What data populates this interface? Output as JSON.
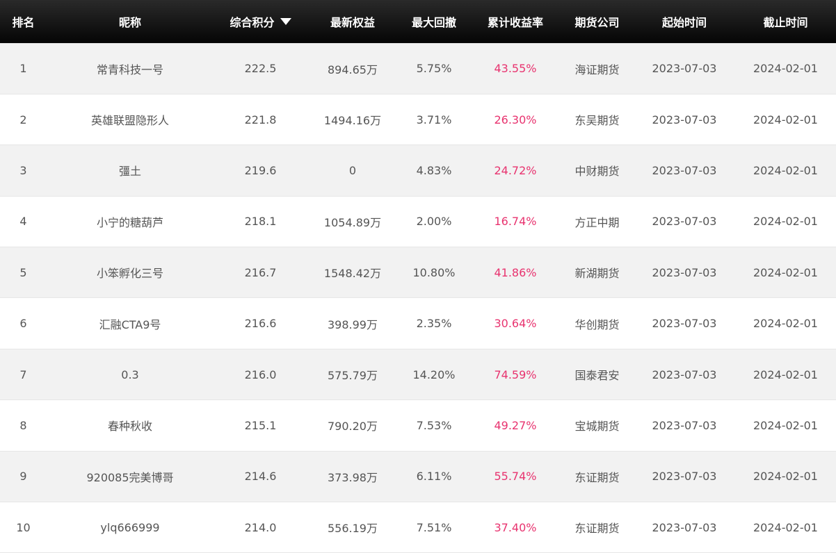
{
  "colors": {
    "header_bg": "#111111",
    "header_text": "#ffffff",
    "row_alt_bg": "#f2f2f2",
    "row_bg": "#ffffff",
    "text": "#555555",
    "rate_text": "#e8336f"
  },
  "headers": {
    "rank": "排名",
    "nickname": "昵称",
    "score": "综合积分",
    "equity": "最新权益",
    "drawdown": "最大回撤",
    "return_rate": "累计收益率",
    "company": "期货公司",
    "start": "起始时间",
    "end": "截止时间"
  },
  "sort_indicator_icon": "triangle-down-icon",
  "rows": [
    {
      "rank": "1",
      "nickname": "常青科技一号",
      "score": "222.5",
      "equity": "894.65万",
      "drawdown": "5.75%",
      "return_rate": "43.55%",
      "company": "海证期货",
      "start": "2023-07-03",
      "end": "2024-02-01"
    },
    {
      "rank": "2",
      "nickname": "英雄联盟隐形人",
      "score": "221.8",
      "equity": "1494.16万",
      "drawdown": "3.71%",
      "return_rate": "26.30%",
      "company": "东吴期货",
      "start": "2023-07-03",
      "end": "2024-02-01"
    },
    {
      "rank": "3",
      "nickname": "彊土",
      "score": "219.6",
      "equity": "0",
      "drawdown": "4.83%",
      "return_rate": "24.72%",
      "company": "中财期货",
      "start": "2023-07-03",
      "end": "2024-02-01"
    },
    {
      "rank": "4",
      "nickname": "小宁的糖葫芦",
      "score": "218.1",
      "equity": "1054.89万",
      "drawdown": "2.00%",
      "return_rate": "16.74%",
      "company": "方正中期",
      "start": "2023-07-03",
      "end": "2024-02-01"
    },
    {
      "rank": "5",
      "nickname": "小笨孵化三号",
      "score": "216.7",
      "equity": "1548.42万",
      "drawdown": "10.80%",
      "return_rate": "41.86%",
      "company": "新湖期货",
      "start": "2023-07-03",
      "end": "2024-02-01"
    },
    {
      "rank": "6",
      "nickname": "汇融CTA9号",
      "score": "216.6",
      "equity": "398.99万",
      "drawdown": "2.35%",
      "return_rate": "30.64%",
      "company": "华创期货",
      "start": "2023-07-03",
      "end": "2024-02-01"
    },
    {
      "rank": "7",
      "nickname": "0.3",
      "score": "216.0",
      "equity": "575.79万",
      "drawdown": "14.20%",
      "return_rate": "74.59%",
      "company": "国泰君安",
      "start": "2023-07-03",
      "end": "2024-02-01"
    },
    {
      "rank": "8",
      "nickname": "春种秋收",
      "score": "215.1",
      "equity": "790.20万",
      "drawdown": "7.53%",
      "return_rate": "49.27%",
      "company": "宝城期货",
      "start": "2023-07-03",
      "end": "2024-02-01"
    },
    {
      "rank": "9",
      "nickname": "920085完美博哥",
      "score": "214.6",
      "equity": "373.98万",
      "drawdown": "6.11%",
      "return_rate": "55.74%",
      "company": "东证期货",
      "start": "2023-07-03",
      "end": "2024-02-01"
    },
    {
      "rank": "10",
      "nickname": "ylq666999",
      "score": "214.0",
      "equity": "556.19万",
      "drawdown": "7.51%",
      "return_rate": "37.40%",
      "company": "东证期货",
      "start": "2023-07-03",
      "end": "2024-02-01"
    }
  ]
}
